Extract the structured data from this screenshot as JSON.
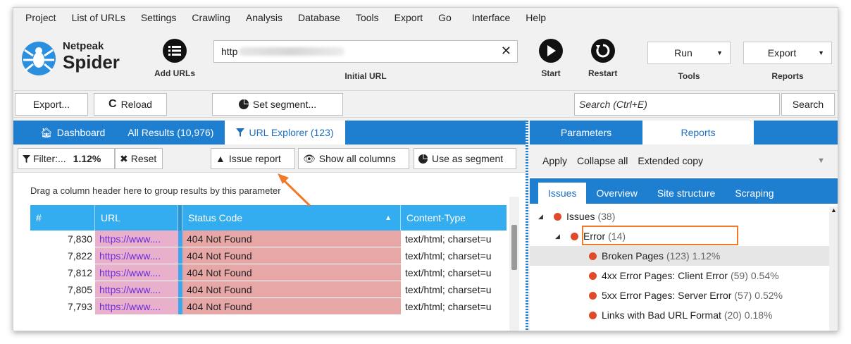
{
  "menu": [
    "Project",
    "List of URLs",
    "Settings",
    "Crawling",
    "Analysis",
    "Database",
    "Tools",
    "Export",
    "Go",
    "Interface",
    "Help"
  ],
  "logo": {
    "line1": "Netpeak",
    "line2": "Spider"
  },
  "toolbar": {
    "add_urls_label": "Add URLs",
    "url_prefix": "http",
    "url_clear": "✕",
    "url_caption": "Initial URL",
    "start_label": "Start",
    "restart_label": "Restart",
    "tools_value": "Run",
    "tools_caption": "Tools",
    "reports_value": "Export",
    "reports_caption": "Reports"
  },
  "subbar": {
    "export_label": "Export...",
    "reload_label": "Reload",
    "segment_label": "Set segment...",
    "search_placeholder": "Search (Ctrl+E)",
    "search_button": "Search"
  },
  "left_tabs": [
    {
      "label": "Dashboard",
      "icon": "home-icon"
    },
    {
      "label": "All Results (10,976)"
    },
    {
      "label": "URL Explorer (123)",
      "icon": "filter-icon",
      "active": true
    }
  ],
  "filterbar": {
    "filter_label": "Filter:...",
    "filter_value": "1.12%",
    "reset_label": "Reset",
    "issue_report_label": "Issue report",
    "show_all_label": "Show all columns",
    "use_segment_label": "Use as segment"
  },
  "group_hint": "Drag a column header here to group results by this parameter",
  "grid": {
    "headers": [
      "#",
      "URL",
      "Status Code",
      "Content-Type"
    ],
    "sort_indicator": "▲",
    "rows": [
      {
        "num": "7,830",
        "url": "https://www....",
        "status": "404 Not Found",
        "ct": "text/html; charset=u"
      },
      {
        "num": "7,822",
        "url": "https://www....",
        "status": "404 Not Found",
        "ct": "text/html; charset=u"
      },
      {
        "num": "7,812",
        "url": "https://www....",
        "status": "404 Not Found",
        "ct": "text/html; charset=u"
      },
      {
        "num": "7,805",
        "url": "https://www....",
        "status": "404 Not Found",
        "ct": "text/html; charset=u"
      },
      {
        "num": "7,793",
        "url": "https://www....",
        "status": "404 Not Found",
        "ct": "text/html; charset=u"
      }
    ]
  },
  "right_tabs": [
    "Parameters",
    "Reports"
  ],
  "right_actions": [
    "Apply",
    "Collapse all",
    "Extended copy"
  ],
  "right_subtabs": [
    "Issues",
    "Overview",
    "Site structure",
    "Scraping"
  ],
  "tree": {
    "issues": {
      "label": "Issues",
      "count": "(38)"
    },
    "error": {
      "label": "Error",
      "count": "(14)"
    },
    "items": [
      {
        "label": "Broken Pages",
        "count": "(123)",
        "pct": "1.12%"
      },
      {
        "label": "4xx Error Pages: Client Error",
        "count": "(59)",
        "pct": "0.54%"
      },
      {
        "label": "5xx Error Pages: Server Error",
        "count": "(57)",
        "pct": "0.52%"
      },
      {
        "label": "Links with Bad URL Format",
        "count": "(20)",
        "pct": "0.18%"
      }
    ]
  },
  "colors": {
    "accent_blue": "#1e7fd1",
    "grid_header": "#33adf0",
    "status_bg": "#e7a7a7",
    "url_bg": "#e9b0cc",
    "issue_dot": "#e04a2a",
    "highlight": "#f07a2a"
  }
}
